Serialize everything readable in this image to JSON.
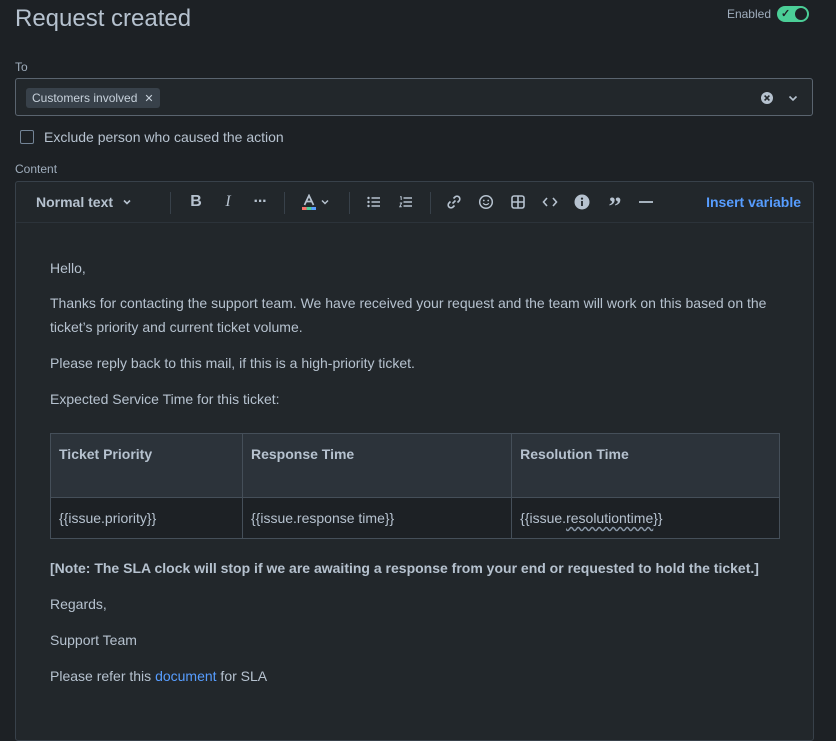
{
  "page": {
    "title": "Request created"
  },
  "enabled_toggle": {
    "label": "Enabled",
    "on": true,
    "color": "#4bce97"
  },
  "to_field": {
    "label": "To",
    "chips": [
      {
        "label": "Customers involved",
        "remove_icon": "close-icon"
      }
    ]
  },
  "exclude_checkbox": {
    "label": "Exclude person who caused the action",
    "checked": false
  },
  "content_field": {
    "label": "Content"
  },
  "toolbar": {
    "text_style": "Normal text",
    "insert_variable": "Insert variable",
    "icons": [
      "bold-icon",
      "italic-icon",
      "more-formatting-icon",
      "text-color-icon",
      "bullet-list-icon",
      "numbered-list-icon",
      "link-icon",
      "emoji-icon",
      "table-icon",
      "code-icon",
      "info-panel-icon",
      "quote-icon",
      "divider-icon"
    ]
  },
  "body": {
    "greeting": "Hello,",
    "thanks": "Thanks for contacting the support team. We have received your request and the team will work on this based on the ticket’s priority and current ticket volume.",
    "reply": "Please reply back to this mail, if this is a high-priority ticket.",
    "expected": "Expected Service Time for this ticket:",
    "table": {
      "headers": [
        "Ticket Priority",
        "Response Time",
        "Resolution Time"
      ],
      "row": [
        "{{issue.priority}}",
        "{{issue.response time}}",
        "{{issue.resolutiontime}}"
      ],
      "row_parts": {
        "res_prefix": "{{issue.",
        "res_word": "resolutiontime",
        "res_suffix": "}}"
      }
    },
    "note": "[Note: The SLA clock will stop if we are awaiting a response from your end or requested to hold the ticket.]",
    "regards": "Regards,",
    "team": "Support Team",
    "refer_prefix": "Please refer this ",
    "refer_link": "document",
    "refer_suffix": " for SLA"
  },
  "colors": {
    "background": "#1d2125",
    "accent": "#579dff",
    "toggle_on": "#4bce97"
  }
}
